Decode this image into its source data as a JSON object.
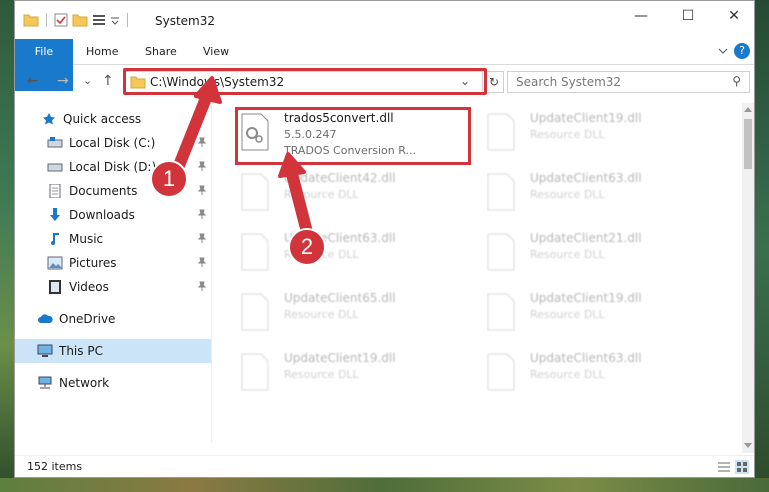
{
  "window": {
    "title": "System32",
    "minimize_glyph": "—",
    "maximize_glyph": "☐",
    "close_glyph": "✕"
  },
  "ribbon": {
    "tabs": [
      "File",
      "Home",
      "Share",
      "View"
    ]
  },
  "nav": {
    "back": "←",
    "forward": "→",
    "down": "⌄",
    "up": "↑",
    "address": "C:\\Windows\\System32",
    "address_chevron": "⌄",
    "refresh": "↻",
    "search_placeholder": "Search System32",
    "search_glyph": "⚲"
  },
  "sidebar": {
    "items": [
      {
        "label": "Quick access",
        "icon": "star-icon"
      },
      {
        "label": "Local Disk (C:)",
        "icon": "drive-icon"
      },
      {
        "label": "Local Disk (D:)",
        "icon": "drive-icon"
      },
      {
        "label": "Documents",
        "icon": "documents-icon"
      },
      {
        "label": "Downloads",
        "icon": "downloads-icon"
      },
      {
        "label": "Music",
        "icon": "music-icon"
      },
      {
        "label": "Pictures",
        "icon": "pictures-icon"
      },
      {
        "label": "Videos",
        "icon": "videos-icon"
      },
      {
        "label": "OneDrive",
        "icon": "cloud-icon"
      },
      {
        "label": "This PC",
        "icon": "computer-icon"
      },
      {
        "label": "Network",
        "icon": "network-icon"
      }
    ]
  },
  "files": [
    {
      "name": "trados5convert.dll",
      "line2": "5.5.0.247",
      "line3": "TRADOS Conversion R..."
    },
    {
      "name": "UpdateClient19.dll",
      "line2": "Resource DLL"
    },
    {
      "name": "UpdateClient42.dll",
      "line2": "Resource DLL"
    },
    {
      "name": "UpdateClient63.dll",
      "line2": "Resource DLL"
    },
    {
      "name": "UpdateClient63.dll",
      "line2": "Resource DLL"
    },
    {
      "name": "UpdateClient21.dll",
      "line2": "Resource DLL"
    },
    {
      "name": "UpdateClient65.dll",
      "line2": "Resource DLL"
    },
    {
      "name": "UpdateClient19.dll",
      "line2": "Resource DLL"
    },
    {
      "name": "UpdateClient19.dll",
      "line2": "Resource DLL"
    },
    {
      "name": "UpdateClient63.dll",
      "line2": "Resource DLL"
    }
  ],
  "status": {
    "count": "152 items"
  },
  "annotations": {
    "step1": "1",
    "step2": "2"
  },
  "colors": {
    "accent": "#1979ca",
    "highlight": "#d1343a",
    "selection": "#cce4f7"
  }
}
